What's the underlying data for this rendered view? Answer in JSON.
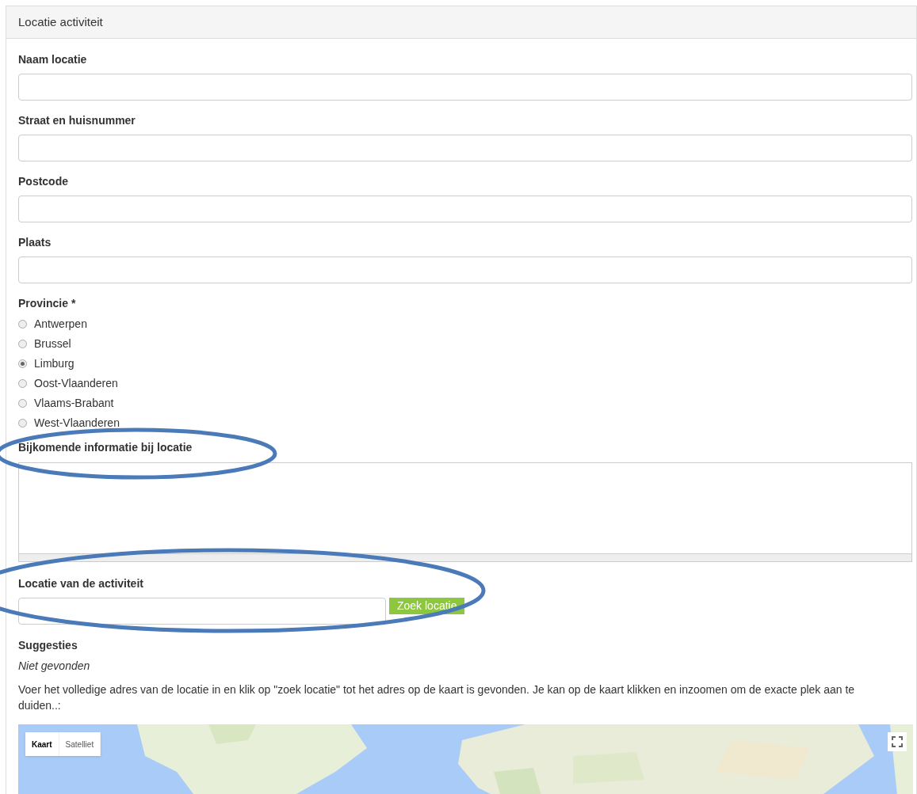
{
  "panel": {
    "title": "Locatie activiteit"
  },
  "text_fields": [
    {
      "label": "Naam locatie"
    },
    {
      "label": "Straat en huisnummer"
    },
    {
      "label": "Postcode"
    },
    {
      "label": "Plaats"
    }
  ],
  "province": {
    "label": "Provincie *",
    "options": [
      {
        "label": "Antwerpen",
        "selected": false
      },
      {
        "label": "Brussel",
        "selected": false
      },
      {
        "label": "Limburg",
        "selected": true
      },
      {
        "label": "Oost-Vlaanderen",
        "selected": false
      },
      {
        "label": "Vlaams-Brabant",
        "selected": false
      },
      {
        "label": "West-Vlaanderen",
        "selected": false
      }
    ]
  },
  "extra_info": {
    "label": "Bijkomende informatie bij locatie"
  },
  "location_search": {
    "label": "Locatie van de activiteit",
    "button": "Zoek locatie"
  },
  "suggestions": {
    "label": "Suggesties",
    "result": "Niet gevonden"
  },
  "instructions": "Voer het volledige adres van de locatie in en klik op \"zoek locatie\" tot het adres op de kaart is gevonden. Je kan op de kaart klikken en inzoomen om de exacte plek aan te duiden..:",
  "map": {
    "map_types": [
      {
        "label": "Kaart",
        "selected": true
      },
      {
        "label": "Satelliet",
        "selected": false
      }
    ]
  }
}
